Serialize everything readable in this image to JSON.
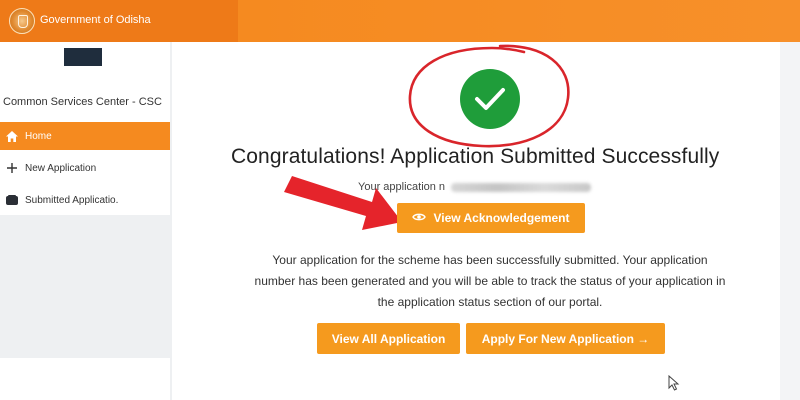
{
  "header": {
    "title": "Government of Odisha"
  },
  "sidebar": {
    "brand": "Common Services Center - CSC",
    "items": [
      {
        "label": "Home",
        "icon": "home-icon",
        "active": true
      },
      {
        "label": "New Application",
        "icon": "plus-icon",
        "active": false
      },
      {
        "label": "Submitted Applicatio.",
        "icon": "folder-icon",
        "active": false
      }
    ]
  },
  "main": {
    "headline": "Congratulations! Application Submitted Successfully",
    "application_number_label": "Your application n",
    "ack_button": "View Acknowledgement",
    "description": "Your application for the scheme has been successfully submitted. Your application number has been generated and you will be able to track the status of your application in the application status section of our portal.",
    "view_all_button": "View All Application",
    "apply_new_button": "Apply For New Application →"
  },
  "colors": {
    "brand_orange": "#f58a1f",
    "button_orange": "#f59a1e",
    "success_green": "#1f9d3a",
    "annotation_red": "#e5242b"
  }
}
